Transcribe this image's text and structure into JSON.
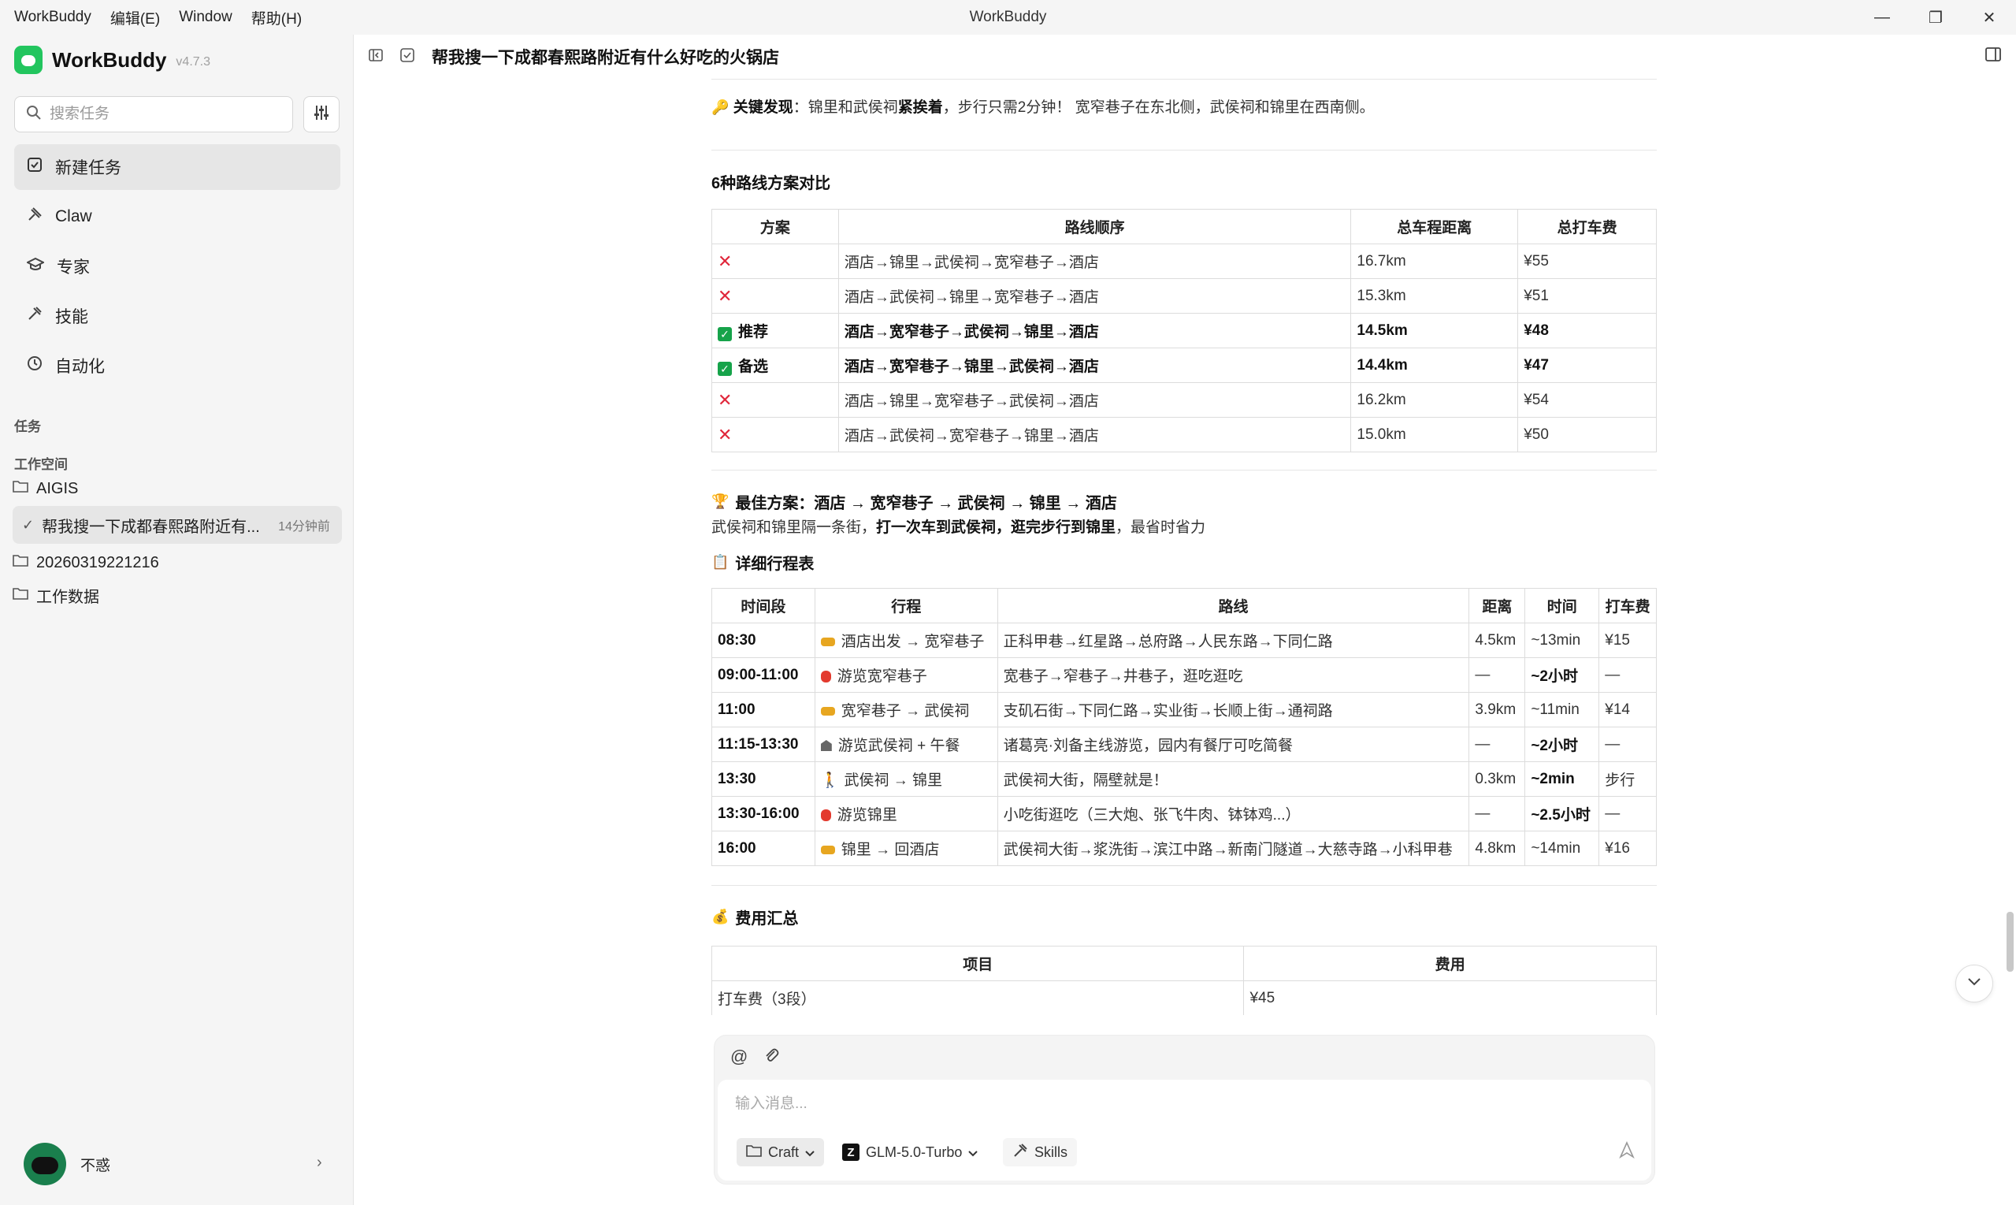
{
  "window": {
    "menus": [
      "WorkBuddy",
      "编辑(E)",
      "Window",
      "帮助(H)"
    ],
    "title": "WorkBuddy",
    "controls": [
      "—",
      "❐",
      "✕"
    ]
  },
  "sidebar": {
    "brand": "WorkBuddy",
    "version": "v4.7.3",
    "search_placeholder": "搜索任务",
    "nav": [
      {
        "label": "新建任务",
        "icon": "new-task-icon"
      },
      {
        "label": "Claw",
        "icon": "claw-icon"
      },
      {
        "label": "专家",
        "icon": "expert-icon"
      },
      {
        "label": "技能",
        "icon": "skills-icon"
      },
      {
        "label": "自动化",
        "icon": "clock-icon"
      }
    ],
    "tasks_label": "任务",
    "workspace_label": "工作空间",
    "folders": [
      "AIGIS",
      "20260319221216",
      "工作数据"
    ],
    "active_task": {
      "title": "帮我搜一下成都春熙路附近有...",
      "time": "14分钟前"
    },
    "user": {
      "name": "不惑"
    }
  },
  "header": {
    "title": "帮我搜一下成都春熙路附近有什么好吃的火锅店"
  },
  "content": {
    "key_finding_label": "关键发现",
    "key_finding_pre": "：锦里和武侯祠",
    "key_finding_bold": "紧挨着",
    "key_finding_post": "，步行只需2分钟！ 宽窄巷子在东北侧，武侯祠和锦里在西南侧。",
    "routes_title": "6种路线方案对比",
    "routes_headers": [
      "方案",
      "路线顺序",
      "总车程距离",
      "总打车费"
    ],
    "routes": [
      {
        "mark": "x",
        "label": "",
        "route": "酒店→锦里→武侯祠→宽窄巷子→酒店",
        "dist": "16.7km",
        "fee": "¥55",
        "bold": false
      },
      {
        "mark": "x",
        "label": "",
        "route": "酒店→武侯祠→锦里→宽窄巷子→酒店",
        "dist": "15.3km",
        "fee": "¥51",
        "bold": false
      },
      {
        "mark": "check",
        "label": "推荐",
        "route": "酒店→宽窄巷子→武侯祠→锦里→酒店",
        "dist": "14.5km",
        "fee": "¥48",
        "bold": true
      },
      {
        "mark": "check",
        "label": "备选",
        "route": "酒店→宽窄巷子→锦里→武侯祠→酒店",
        "dist": "14.4km",
        "fee": "¥47",
        "bold": true
      },
      {
        "mark": "x",
        "label": "",
        "route": "酒店→锦里→宽窄巷子→武侯祠→酒店",
        "dist": "16.2km",
        "fee": "¥54",
        "bold": false
      },
      {
        "mark": "x",
        "label": "",
        "route": "酒店→武侯祠→宽窄巷子→锦里→酒店",
        "dist": "15.0km",
        "fee": "¥50",
        "bold": false
      }
    ],
    "best_title": "最佳方案：酒店 → 宽窄巷子 → 武侯祠 → 锦里 → 酒店",
    "best_desc_pre": "武侯祠和锦里隔一条街，",
    "best_desc_bold": "打一次车到武侯祠，逛完步行到锦里",
    "best_desc_post": "，最省时省力",
    "itinerary_title": "详细行程表",
    "itinerary_headers": [
      "时间段",
      "行程",
      "路线",
      "距离",
      "时间",
      "打车费"
    ],
    "itinerary": [
      {
        "time": "08:30",
        "icon": "car",
        "trip": "酒店出发 → 宽窄巷子",
        "route": "正科甲巷→红星路→总府路→人民东路→下同仁路",
        "dist": "4.5km",
        "dur": "~13min",
        "fee": "¥15",
        "dur_bold": false
      },
      {
        "time": "09:00-11:00",
        "icon": "dot",
        "trip": "游览宽窄巷子",
        "route": "宽巷子→窄巷子→井巷子，逛吃逛吃",
        "dist": "—",
        "dur": "~2小时",
        "fee": "—",
        "dur_bold": true
      },
      {
        "time": "11:00",
        "icon": "car",
        "trip": "宽窄巷子 → 武侯祠",
        "route": "支矶石街→下同仁路→实业街→长顺上街→通祠路",
        "dist": "3.9km",
        "dur": "~11min",
        "fee": "¥14",
        "dur_bold": false
      },
      {
        "time": "11:15-13:30",
        "icon": "temple",
        "trip": "游览武侯祠 + 午餐",
        "route": "诸葛亮·刘备主线游览，园内有餐厅可吃简餐",
        "dist": "—",
        "dur": "~2小时",
        "fee": "—",
        "dur_bold": true
      },
      {
        "time": "13:30",
        "icon": "walk",
        "trip": "武侯祠 → 锦里",
        "route": "武侯祠大街，隔壁就是！",
        "dist": "0.3km",
        "dur": "~2min",
        "fee": "步行",
        "dur_bold": true
      },
      {
        "time": "13:30-16:00",
        "icon": "dot",
        "trip": "游览锦里",
        "route": "小吃街逛吃（三大炮、张飞牛肉、钵钵鸡...）",
        "dist": "—",
        "dur": "~2.5小时",
        "fee": "—",
        "dur_bold": true
      },
      {
        "time": "16:00",
        "icon": "car",
        "trip": "锦里 → 回酒店",
        "route": "武侯祠大街→浆洗街→滨江中路→新南门隧道→大慈寺路→小科甲巷",
        "dist": "4.8km",
        "dur": "~14min",
        "fee": "¥16",
        "dur_bold": false
      }
    ],
    "cost_title": "费用汇总",
    "cost_headers": [
      "项目",
      "费用"
    ],
    "cost_row": {
      "item": "打车费（3段）",
      "value": "¥45"
    }
  },
  "composer": {
    "placeholder": "输入消息...",
    "mode": "Craft",
    "model": "GLM-5.0-Turbo",
    "skills": "Skills"
  },
  "colors": {
    "accent": "#22c55e",
    "x_mark": "#e0263a",
    "check": "#16a34a"
  }
}
